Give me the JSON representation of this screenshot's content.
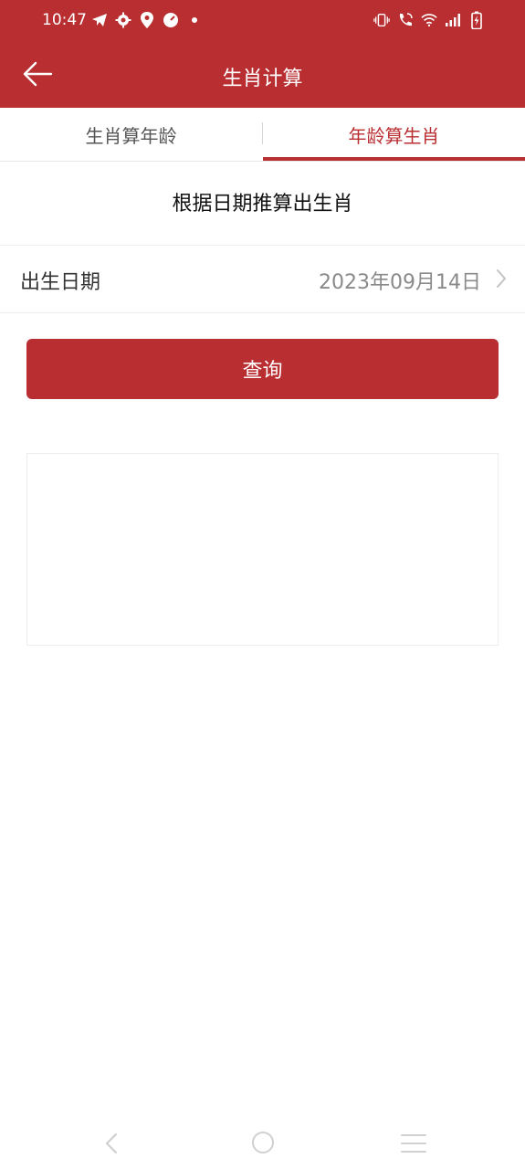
{
  "status_bar": {
    "time": "10:47",
    "left_icons": [
      "telegram-icon",
      "settings-icon",
      "location-icon",
      "speed-icon",
      "dot-icon"
    ],
    "right_icons": [
      "vibrate-icon",
      "wifi-call-icon",
      "wifi-icon",
      "signal-icon",
      "battery-charging-icon"
    ]
  },
  "app_bar": {
    "title": "生肖计算",
    "back_icon": "arrow-left-icon"
  },
  "tabs": [
    {
      "label": "生肖算年龄",
      "active": false
    },
    {
      "label": "年龄算生肖",
      "active": true
    }
  ],
  "section": {
    "title": "根据日期推算出生肖"
  },
  "birth_date": {
    "label": "出生日期",
    "value": "2023年09月14日",
    "icon": "chevron-right-icon"
  },
  "query_button": {
    "label": "查询"
  },
  "result": {
    "text": ""
  },
  "nav_bar": {
    "icons": [
      "nav-back-icon",
      "nav-home-icon",
      "nav-menu-icon"
    ]
  },
  "colors": {
    "brand": "#b92e31",
    "background": "#ffffff",
    "muted_text": "#8a8a8a"
  }
}
